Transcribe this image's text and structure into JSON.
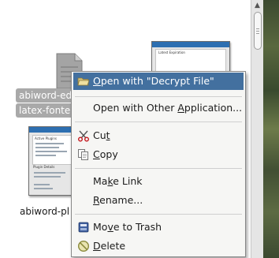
{
  "file_view": {
    "items": [
      {
        "label_line1": "abiword-ed",
        "label_line2": "latex-fonte",
        "icon": "generic-document-icon",
        "selected": true
      },
      {
        "label_line1": "abiword-pl",
        "icon": "image-thumbnail",
        "selected": false
      },
      {
        "icon": "image-thumbnail",
        "selected": false
      }
    ],
    "thumbnail_top_title": "Latest Expiration",
    "thumbnail_plugin_texts": {
      "active_plugins": "Active Plugins",
      "plugin_details": "Plugin Details"
    }
  },
  "scrollbar": {
    "up_arrow": "▲"
  },
  "context_menu": {
    "items": [
      {
        "key": "open_decrypt",
        "pre": "",
        "accel": "O",
        "post": "pen with \"Decrypt File\"",
        "icon": "folder-open-icon",
        "highlighted": true
      },
      {
        "key": "open_other",
        "pre": "Open with Other ",
        "accel": "A",
        "post": "pplication...",
        "icon": "",
        "highlighted": false
      },
      {
        "key": "cut",
        "pre": "Cu",
        "accel": "t",
        "post": "",
        "icon": "scissors-icon",
        "highlighted": false
      },
      {
        "key": "copy",
        "pre": "",
        "accel": "C",
        "post": "opy",
        "icon": "copy-icon",
        "highlighted": false
      },
      {
        "key": "make_link",
        "pre": "Ma",
        "accel": "k",
        "post": "e Link",
        "icon": "",
        "highlighted": false
      },
      {
        "key": "rename",
        "pre": "",
        "accel": "R",
        "post": "ename...",
        "icon": "",
        "highlighted": false
      },
      {
        "key": "move_trash",
        "pre": "Mo",
        "accel": "v",
        "post": "e to Trash",
        "icon": "trash-icon",
        "highlighted": false
      },
      {
        "key": "delete",
        "pre": "",
        "accel": "D",
        "post": "elete",
        "icon": "delete-icon",
        "highlighted": false
      }
    ]
  },
  "colors": {
    "menu_highlight": "#43709f",
    "selection_bg": "#a9a9a9",
    "menu_bg": "#f6f6f4"
  }
}
